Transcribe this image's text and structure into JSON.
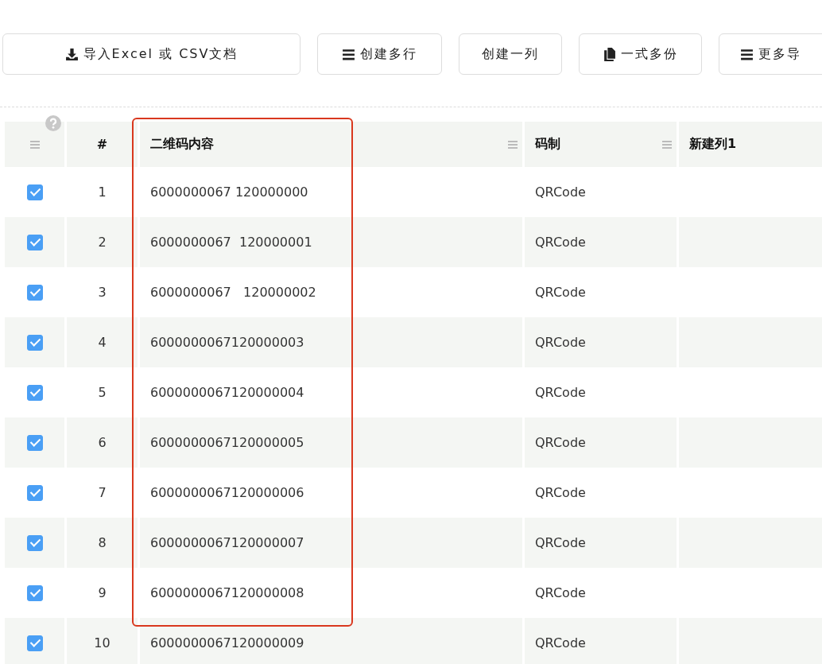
{
  "toolbar": [
    {
      "label": "导入Excel 或 CSV文档"
    },
    {
      "label": "创建多行"
    },
    {
      "label": "创建一列"
    },
    {
      "label": "一式多份"
    },
    {
      "label": "更多导"
    }
  ],
  "table": {
    "columns": [
      {
        "kind": "select"
      },
      {
        "label": "#",
        "kind": "index"
      },
      {
        "label": "二维码内容",
        "kind": "data"
      },
      {
        "label": "码制",
        "kind": "data"
      },
      {
        "label": "新建列1",
        "kind": "data"
      }
    ],
    "rows": [
      {
        "checked": true,
        "index": "1",
        "content": "6000000067 120000000",
        "type": "QRCode",
        "column_5": ""
      },
      {
        "checked": true,
        "index": "2",
        "content": "6000000067  120000001",
        "type": "QRCode",
        "column_5": ""
      },
      {
        "checked": true,
        "index": "3",
        "content": "6000000067   120000002",
        "type": "QRCode",
        "column_5": ""
      },
      {
        "checked": true,
        "index": "4",
        "content": "6000000067120000003",
        "type": "QRCode",
        "column_5": ""
      },
      {
        "checked": true,
        "index": "5",
        "content": "6000000067120000004",
        "type": "QRCode",
        "column_5": ""
      },
      {
        "checked": true,
        "index": "6",
        "content": "6000000067120000005",
        "type": "QRCode",
        "column_5": ""
      },
      {
        "checked": true,
        "index": "7",
        "content": "6000000067120000006",
        "type": "QRCode",
        "column_5": ""
      },
      {
        "checked": true,
        "index": "8",
        "content": "6000000067120000007",
        "type": "QRCode",
        "column_5": ""
      },
      {
        "checked": true,
        "index": "9",
        "content": "6000000067120000008",
        "type": "QRCode",
        "column_5": ""
      },
      {
        "checked": true,
        "index": "10",
        "content": "6000000067120000009",
        "type": "QRCode",
        "column_5": ""
      }
    ]
  }
}
